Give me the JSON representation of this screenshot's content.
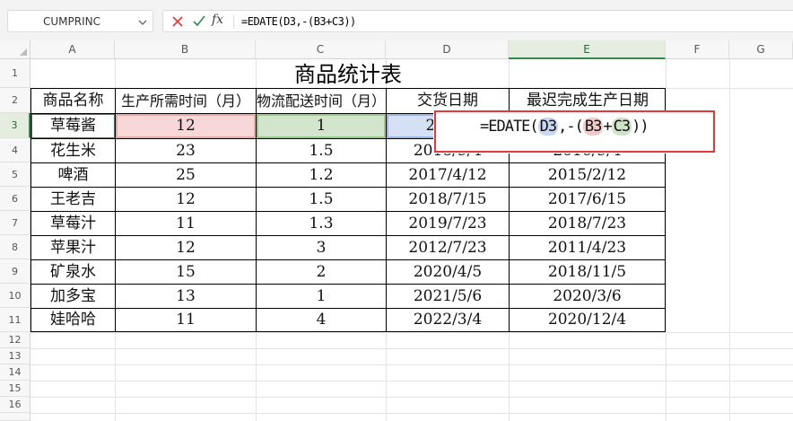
{
  "formula_bar": {
    "name_box": "CUMPRINC",
    "fx_label": "fx",
    "formula": "=EDATE(D3,-(B3+C3))"
  },
  "columns": [
    "A",
    "B",
    "C",
    "D",
    "E",
    "F",
    "G"
  ],
  "rows": [
    "1",
    "2",
    "3",
    "4",
    "5",
    "6",
    "7",
    "8",
    "9",
    "10",
    "11",
    "12",
    "13",
    "14",
    "15",
    "16"
  ],
  "sheet": {
    "title": "商品统计表",
    "headers": [
      "商品名称",
      "生产所需时间（月）",
      "物流配送时间（月）",
      "交货日期",
      "最迟完成生产日期"
    ],
    "rows": [
      {
        "name": "草莓酱",
        "prod": "12",
        "ship": "1",
        "delivery": "2021/",
        "latest": ""
      },
      {
        "name": "花生米",
        "prod": "23",
        "ship": "1.5",
        "delivery": "2018/9/4",
        "latest": "2016/9/4"
      },
      {
        "name": "啤酒",
        "prod": "25",
        "ship": "1.2",
        "delivery": "2017/4/12",
        "latest": "2015/2/12"
      },
      {
        "name": "王老吉",
        "prod": "12",
        "ship": "1.5",
        "delivery": "2018/7/15",
        "latest": "2017/6/15"
      },
      {
        "name": "草莓汁",
        "prod": "11",
        "ship": "1.3",
        "delivery": "2019/7/23",
        "latest": "2018/7/23"
      },
      {
        "name": "苹果汁",
        "prod": "12",
        "ship": "3",
        "delivery": "2012/7/23",
        "latest": "2011/4/23"
      },
      {
        "name": "矿泉水",
        "prod": "15",
        "ship": "2",
        "delivery": "2020/4/5",
        "latest": "2018/11/5"
      },
      {
        "name": "加多宝",
        "prod": "13",
        "ship": "1",
        "delivery": "2021/5/6",
        "latest": "2020/3/6"
      },
      {
        "name": "娃哈哈",
        "prod": "11",
        "ship": "4",
        "delivery": "2022/3/4",
        "latest": "2020/12/4"
      }
    ]
  },
  "edit": {
    "prefix": "=EDATE(",
    "ref_d": "D3",
    "mid": ",-(",
    "ref_b": "B3",
    "plus": "+",
    "ref_c": "C3",
    "suffix": "))"
  },
  "colors": {
    "accent_green": "#2f8b4e",
    "highlight_red_box": "#e03a3a",
    "ref_b_fill": "#f1c9c9",
    "ref_c_fill": "#cfe3c8",
    "ref_d_fill": "#c9d6f1"
  }
}
